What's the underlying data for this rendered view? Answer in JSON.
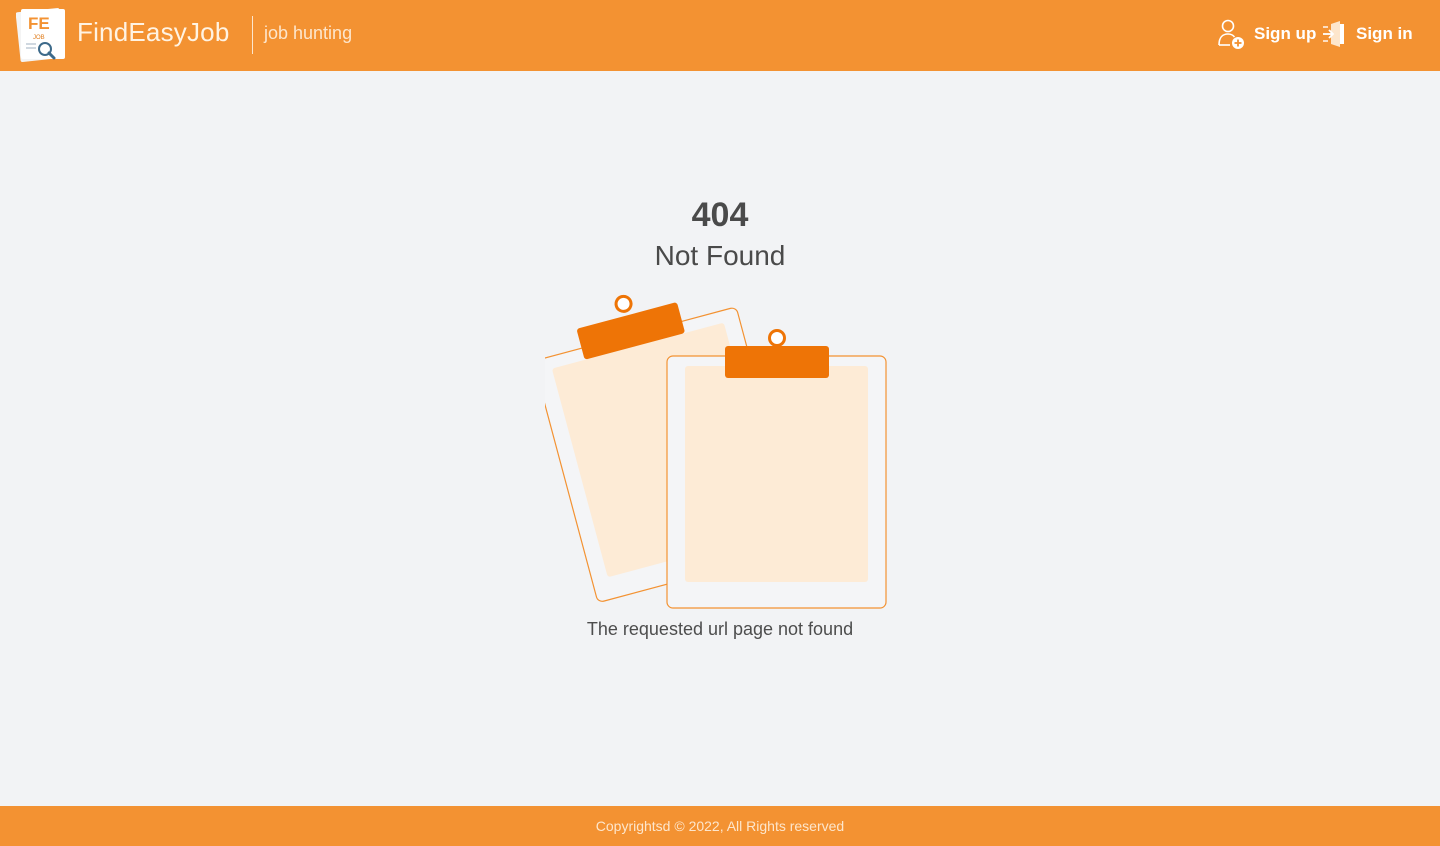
{
  "header": {
    "brand": "FindEasyJob",
    "tagline": "job hunting",
    "logo_letters": "FE",
    "logo_sub": "JOB",
    "sign_up_label": "Sign up",
    "sign_in_label": "Sign in"
  },
  "error": {
    "code": "404",
    "title": "Not Found",
    "message": "The requested url page not found"
  },
  "footer": {
    "copyright": "Copyrightsd © 2022, All Rights reserved"
  },
  "colors": {
    "accent": "#f39232",
    "clip": "#ee7406",
    "paper": "#fdebd6",
    "background": "#f2f3f5"
  },
  "icons": {
    "logo": "findeasyjob-logo",
    "sign_up": "add-user-icon",
    "sign_in": "sign-in-door-icon"
  }
}
